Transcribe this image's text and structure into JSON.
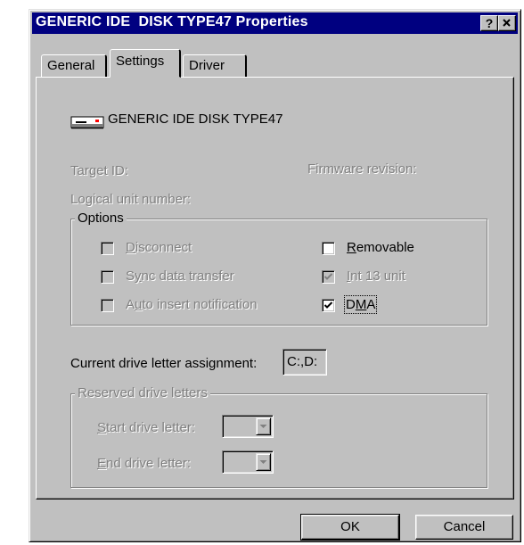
{
  "window": {
    "title": "GENERIC IDE  DISK TYPE47 Properties",
    "help_button": "?",
    "close_button": "✕"
  },
  "tabs": [
    {
      "label": "General"
    },
    {
      "label": "Settings",
      "active": true
    },
    {
      "label": "Driver"
    }
  ],
  "device": {
    "icon": "drive-icon",
    "name": "GENERIC IDE  DISK TYPE47"
  },
  "info": {
    "target_id_label": "Target ID:",
    "firmware_label": "Firmware revision:",
    "lun_label": "Logical unit number:"
  },
  "options": {
    "legend": "Options",
    "disconnect": {
      "label_u": "D",
      "label_rest": "isconnect",
      "checked": false,
      "enabled": false
    },
    "sync": {
      "label_pre": "S",
      "label_u": "y",
      "label_rest": "nc data transfer",
      "checked": false,
      "enabled": false
    },
    "auto_insert": {
      "label_pre": "A",
      "label_u": "u",
      "label_rest": "to insert notification",
      "checked": false,
      "enabled": false
    },
    "removable": {
      "label_u": "R",
      "label_rest": "emovable",
      "checked": false,
      "enabled": true
    },
    "int13": {
      "label_u": "I",
      "label_rest": "nt 13 unit",
      "checked": true,
      "enabled": false
    },
    "dma": {
      "label_pre": "D",
      "label_u": "M",
      "label_rest": "A",
      "checked": true,
      "enabled": true
    }
  },
  "drive_letter": {
    "label": "Current drive letter assignment:",
    "value": "C:,D:"
  },
  "reserved": {
    "legend": "Reserved drive letters",
    "start": {
      "label_u": "S",
      "label_rest": "tart drive letter:"
    },
    "end": {
      "label_u": "E",
      "label_rest": "nd drive letter:"
    }
  },
  "buttons": {
    "ok": "OK",
    "cancel": "Cancel"
  },
  "colors": {
    "title_bar": "#000080",
    "face": "#c0c0c0",
    "disabled_text": "#808080"
  }
}
